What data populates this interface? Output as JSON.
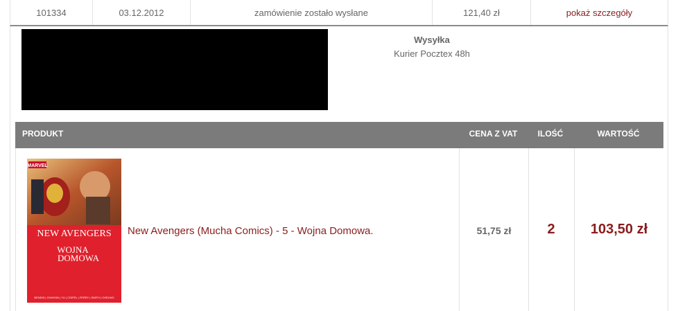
{
  "order": {
    "id": "101334",
    "date": "03.12.2012",
    "status": "zamówienie zostało wysłane",
    "total": "121,40 zł",
    "details_link": "pokaż szczegóły"
  },
  "shipping": {
    "title": "Wysyłka",
    "method": "Kurier Pocztex 48h"
  },
  "products_table": {
    "headers": {
      "product": "PRODUKT",
      "price": "CENA Z VAT",
      "qty": "ILOŚĆ",
      "value": "WARTOŚĆ"
    },
    "rows": [
      {
        "name": "New Avengers (Mucha Comics) - 5 - Wojna Domowa.",
        "unit_price": "51,75 zł",
        "quantity": "2",
        "value": "103,50 zł",
        "cover": {
          "publisher": "MARVEL",
          "title": "NEW AVENGERS",
          "subtitle_1": "WOJNA",
          "subtitle_2": "DOMOWA",
          "credits": "BENDIS | CHAYKIN | YU | COIPEL | FERRY | SMITH | CHEUNG"
        }
      }
    ]
  },
  "colors": {
    "header_bg": "#7b7b7b",
    "accent": "#8a1c1c",
    "cover_red": "#e0202c"
  }
}
